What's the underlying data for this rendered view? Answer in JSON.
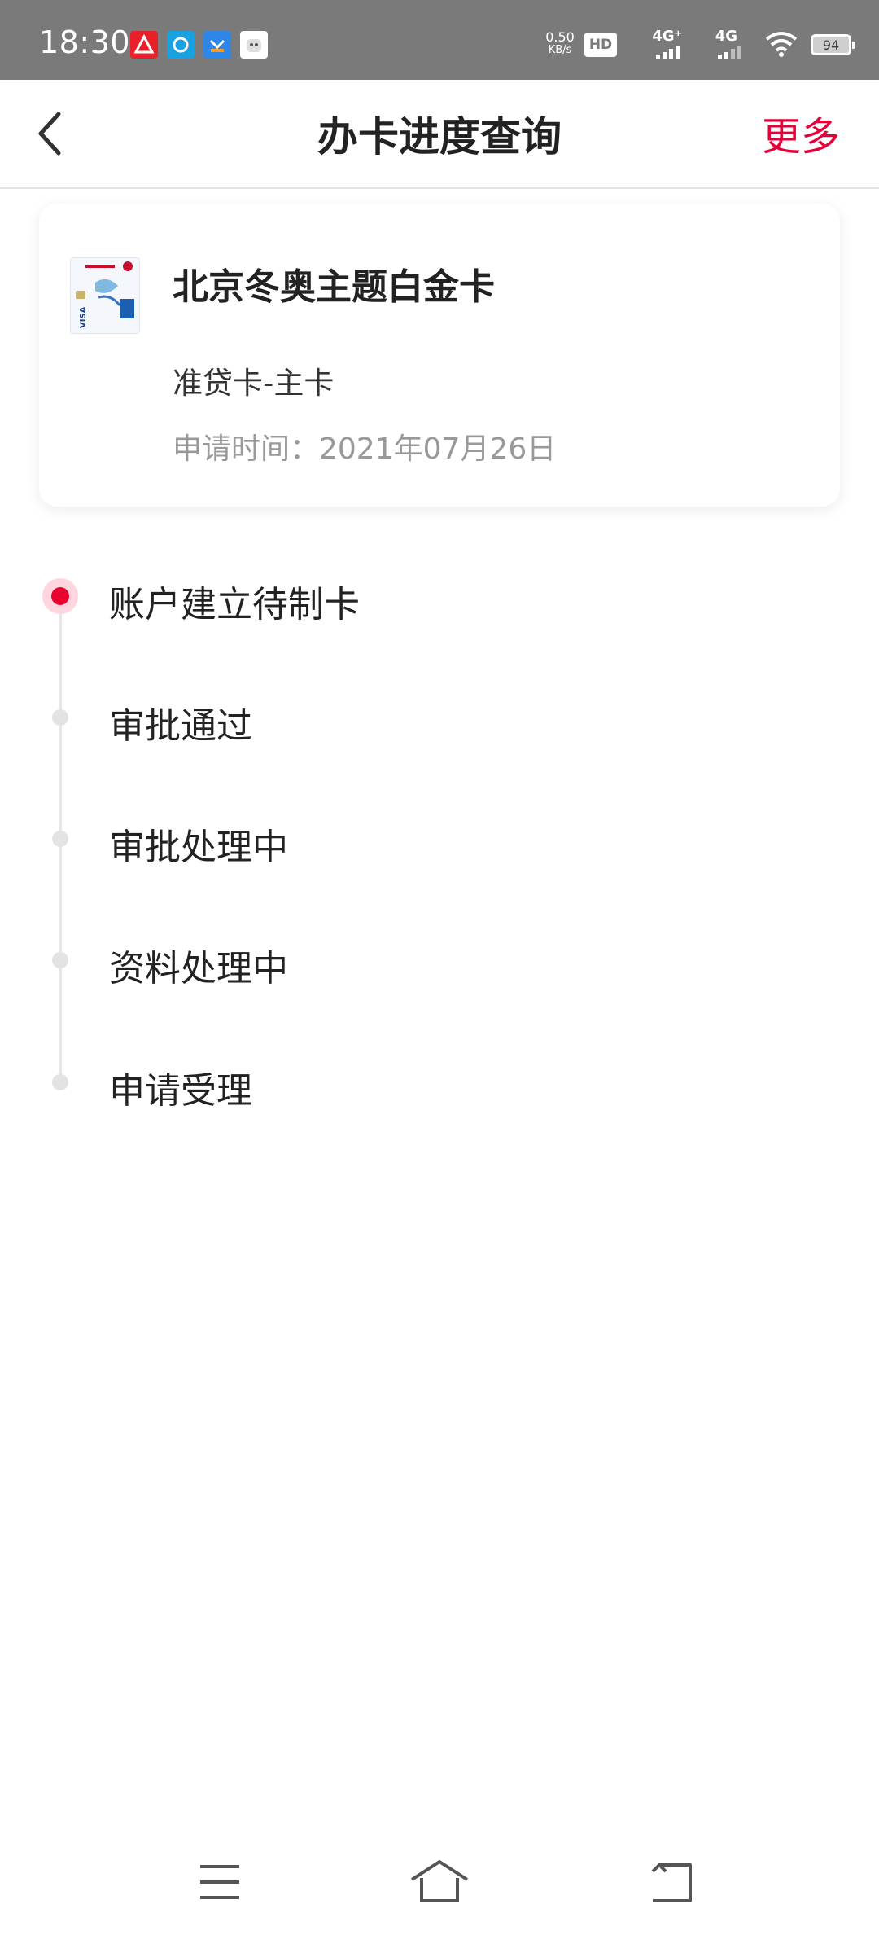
{
  "status_bar": {
    "time": "18:30",
    "net_speed_value": "0.50",
    "net_speed_unit": "KB/s",
    "hd_label": "HD",
    "sim1_label": "4G⁺",
    "sim2_label": "4G",
    "battery": "94",
    "app_icons": [
      "pinduoduo-icon",
      "eleme-icon",
      "app-blue-icon",
      "mascot-icon"
    ]
  },
  "header": {
    "title": "办卡进度查询",
    "more_label": "更多"
  },
  "card_info": {
    "name": "北京冬奥主题白金卡",
    "type": "准贷卡-主卡",
    "apply_time": "申请时间：2021年07月26日"
  },
  "timeline": [
    {
      "label": "账户建立待制卡",
      "active": true
    },
    {
      "label": "审批通过",
      "active": false
    },
    {
      "label": "审批处理中",
      "active": false
    },
    {
      "label": "资料处理中",
      "active": false
    },
    {
      "label": "申请受理",
      "active": false
    }
  ],
  "colors": {
    "accent": "#e5003a",
    "status_bar": "#7a7a7a",
    "muted_text": "#999999"
  },
  "nav_bar": {
    "icons": [
      "menu-icon",
      "home-icon",
      "back-icon"
    ]
  }
}
